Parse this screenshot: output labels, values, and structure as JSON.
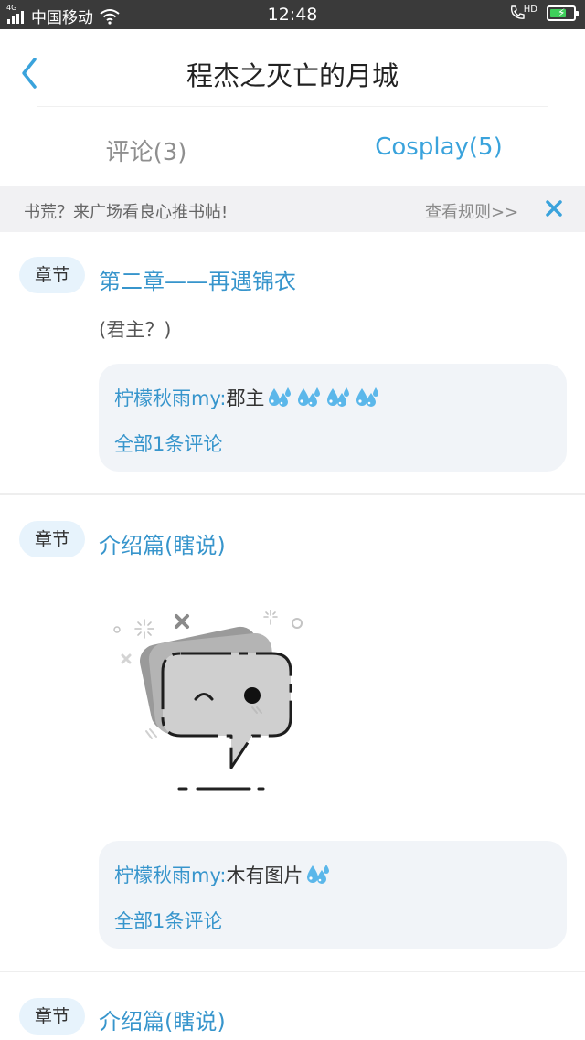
{
  "status_bar": {
    "network": "4G",
    "carrier": "中国移动",
    "time": "12:48",
    "hd_label": "HD",
    "battery_level": 0.7
  },
  "nav": {
    "title": "程杰之灭亡的月城",
    "back_icon": "chevron-left-icon"
  },
  "tabs": [
    {
      "label": "评论(3)",
      "active": false
    },
    {
      "label": "Cosplay(5)",
      "active": true
    }
  ],
  "banner": {
    "text": "书荒？来广场看良心推书帖!",
    "link": "查看规则>>",
    "close_icon": "close-icon"
  },
  "sections": [
    {
      "badge": "章节",
      "title": "第二章——再遇锦衣",
      "body": "(君主？)",
      "comment": {
        "user": "柠檬秋雨my:",
        "text": "郡主",
        "emoji_count": 4,
        "all_comments": "全部1条评论"
      }
    },
    {
      "badge": "章节",
      "title": "介绍篇(瞎说)",
      "image": "no-image-speech-bubble-illustration",
      "comment": {
        "user": "柠檬秋雨my:",
        "text": "木有图片",
        "emoji_count": 1,
        "all_comments": "全部1条评论"
      }
    },
    {
      "badge": "章节",
      "title": "介绍篇(瞎说)"
    }
  ],
  "colors": {
    "accent": "#3aa3dc",
    "link": "#3795cc",
    "badge_bg": "#e7f3fc",
    "comment_bg": "#f1f4f8",
    "banner_bg": "#f1f1f3",
    "status_bar_bg": "#3a3a3a"
  }
}
